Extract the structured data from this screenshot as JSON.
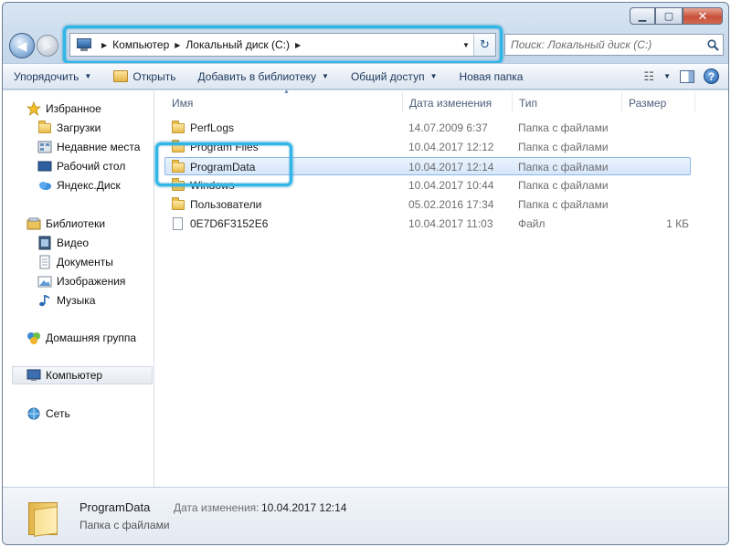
{
  "window": {
    "controls": {
      "minimize": "▁",
      "maximize": "▢",
      "close": "✕"
    }
  },
  "nav": {
    "back": "◀",
    "forward": "▶"
  },
  "address": {
    "crumbs": [
      "Компьютер",
      "Локальный диск (C:)"
    ],
    "separator": "▶",
    "dropdown": "▼",
    "refresh": "↻"
  },
  "search": {
    "placeholder": "Поиск: Локальный диск (C:)"
  },
  "toolbar": {
    "organize": "Упорядочить",
    "open": "Открыть",
    "add_library": "Добавить в библиотеку",
    "share": "Общий доступ",
    "new_folder": "Новая папка",
    "arrow": "▼",
    "views_glyph": "☷",
    "help": "?"
  },
  "sidebar": {
    "favorites": {
      "label": "Избранное",
      "items": [
        "Загрузки",
        "Недавние места",
        "Рабочий стол",
        "Яндекс.Диск"
      ]
    },
    "libraries": {
      "label": "Библиотеки",
      "items": [
        "Видео",
        "Документы",
        "Изображения",
        "Музыка"
      ]
    },
    "homegroup": "Домашняя группа",
    "computer": "Компьютер",
    "network": "Сеть"
  },
  "columns": {
    "name": "Имя",
    "date": "Дата изменения",
    "type": "Тип",
    "size": "Размер",
    "sort_caret": "▲"
  },
  "files": [
    {
      "name": "PerfLogs",
      "date": "14.07.2009 6:37",
      "type": "Папка с файлами",
      "size": "",
      "kind": "folder"
    },
    {
      "name": "Program Files",
      "date": "10.04.2017 12:12",
      "type": "Папка с файлами",
      "size": "",
      "kind": "folder"
    },
    {
      "name": "ProgramData",
      "date": "10.04.2017 12:14",
      "type": "Папка с файлами",
      "size": "",
      "kind": "folder"
    },
    {
      "name": "Windows",
      "date": "10.04.2017 10:44",
      "type": "Папка с файлами",
      "size": "",
      "kind": "folder"
    },
    {
      "name": "Пользователи",
      "date": "05.02.2016 17:34",
      "type": "Папка с файлами",
      "size": "",
      "kind": "folder"
    },
    {
      "name": "0E7D6F3152E6",
      "date": "10.04.2017 11:03",
      "type": "Файл",
      "size": "1 КБ",
      "kind": "file"
    }
  ],
  "details": {
    "name": "ProgramData",
    "type": "Папка с файлами",
    "date_label": "Дата изменения:",
    "date_value": "10.04.2017 12:14"
  },
  "colors": {
    "highlight": "#2fb7e8",
    "selection": "#d5e6fb",
    "link": "#1e395b"
  }
}
